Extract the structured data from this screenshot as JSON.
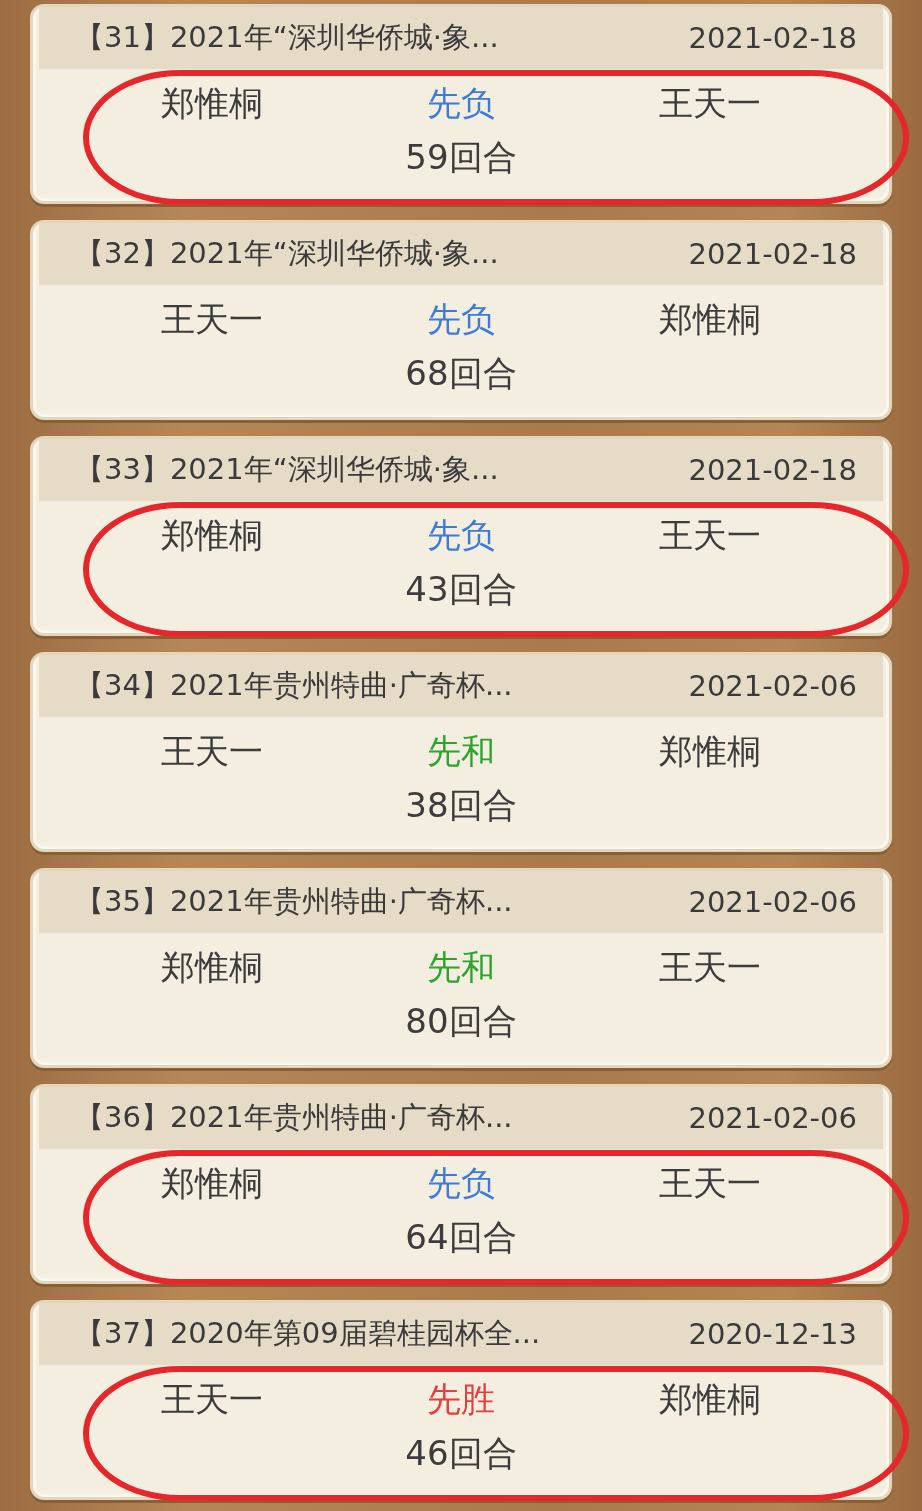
{
  "games": [
    {
      "title": "【31】2021年“深圳华侨城·象...",
      "date": "2021-02-18",
      "red": "郑惟桐",
      "result": "先负",
      "kind": "loss",
      "black": "王天一",
      "moves": "59回合",
      "circled": true
    },
    {
      "title": "【32】2021年“深圳华侨城·象...",
      "date": "2021-02-18",
      "red": "王天一",
      "result": "先负",
      "kind": "loss",
      "black": "郑惟桐",
      "moves": "68回合",
      "circled": false
    },
    {
      "title": "【33】2021年“深圳华侨城·象...",
      "date": "2021-02-18",
      "red": "郑惟桐",
      "result": "先负",
      "kind": "loss",
      "black": "王天一",
      "moves": "43回合",
      "circled": true
    },
    {
      "title": "【34】2021年贵州特曲·广奇杯...",
      "date": "2021-02-06",
      "red": "王天一",
      "result": "先和",
      "kind": "draw",
      "black": "郑惟桐",
      "moves": "38回合",
      "circled": false
    },
    {
      "title": "【35】2021年贵州特曲·广奇杯...",
      "date": "2021-02-06",
      "red": "郑惟桐",
      "result": "先和",
      "kind": "draw",
      "black": "王天一",
      "moves": "80回合",
      "circled": false
    },
    {
      "title": "【36】2021年贵州特曲·广奇杯...",
      "date": "2021-02-06",
      "red": "郑惟桐",
      "result": "先负",
      "kind": "loss",
      "black": "王天一",
      "moves": "64回合",
      "circled": true
    },
    {
      "title": "【37】2020年第09届碧桂园杯全...",
      "date": "2020-12-13",
      "red": "王天一",
      "result": "先胜",
      "kind": "win",
      "black": "郑惟桐",
      "moves": "46回合",
      "circled": true
    }
  ]
}
